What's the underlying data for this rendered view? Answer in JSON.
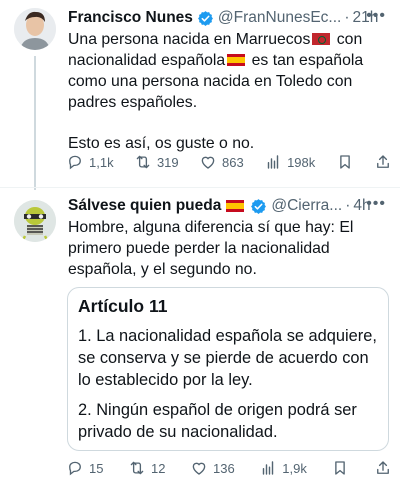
{
  "tweet1": {
    "author_name": "Francisco Nunes",
    "handle": "@FranNunesEc...",
    "time": "21h",
    "text_line1_a": "Una persona nacida en Marruecos",
    "text_line2_a": "nacionalidad española",
    "text_line2_b": "es tan española",
    "text_con": "con",
    "text_rest": "como una persona nacida en Toledo con padres españoles.",
    "text_para2": "Esto es así, os guste o no.",
    "replies": "1,1k",
    "retweets": "319",
    "likes": "863",
    "views": "198k"
  },
  "tweet2": {
    "author_name": "Sálvese quien pueda",
    "handle": "@Cierra...",
    "time": "4h",
    "text": "Hombre, alguna diferencia sí que hay: El primero puede perder la nacionalidad española, y el segundo no.",
    "quote": {
      "title": "Artículo 11",
      "item1": "1. La nacionalidad española se adquiere, se conserva y se pierde de acuerdo con lo establecido por la ley.",
      "item2": "2. Ningún español de origen podrá ser privado de su nacionalidad."
    },
    "replies": "15",
    "retweets": "12",
    "likes": "136",
    "views": "1,9k"
  },
  "colors": {
    "verified": "#1d9bf0",
    "muted": "#536471",
    "text": "#0f1419",
    "border": "#cfd9de"
  },
  "icons": [
    "verified-badge-icon",
    "more-icon",
    "reply-icon",
    "retweet-icon",
    "like-icon",
    "views-icon",
    "bookmark-icon",
    "share-icon",
    "spain-flag-icon",
    "morocco-flag-icon"
  ]
}
